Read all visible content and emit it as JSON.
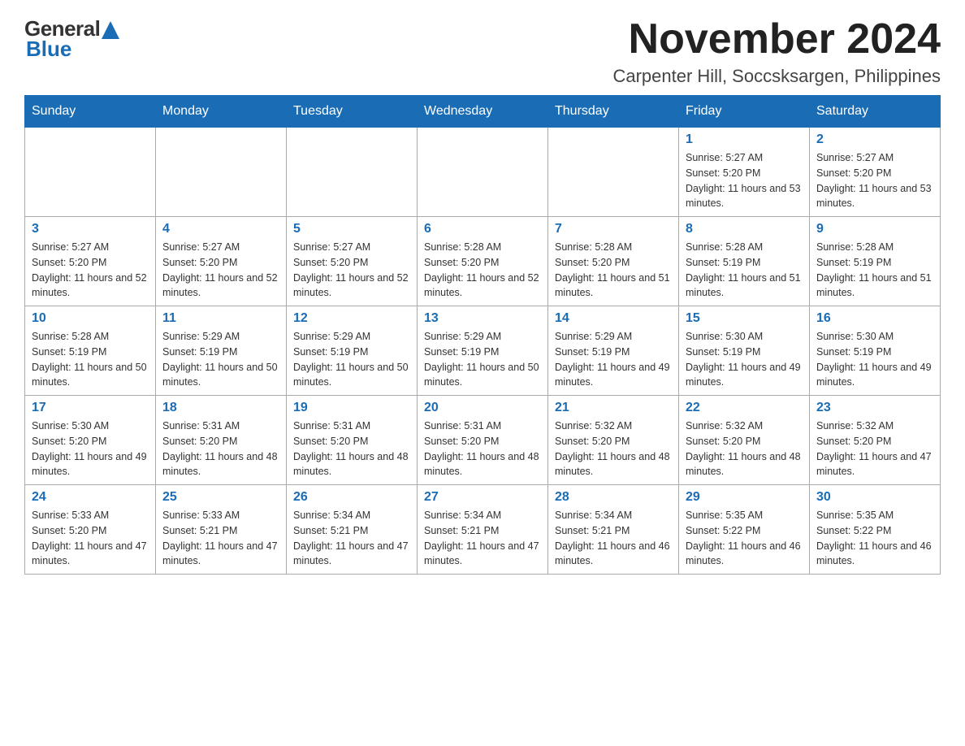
{
  "logo": {
    "general": "General",
    "blue": "Blue"
  },
  "header": {
    "month_year": "November 2024",
    "location": "Carpenter Hill, Soccsksargen, Philippines"
  },
  "weekdays": [
    "Sunday",
    "Monday",
    "Tuesday",
    "Wednesday",
    "Thursday",
    "Friday",
    "Saturday"
  ],
  "weeks": [
    [
      {
        "day": "",
        "sunrise": "",
        "sunset": "",
        "daylight": ""
      },
      {
        "day": "",
        "sunrise": "",
        "sunset": "",
        "daylight": ""
      },
      {
        "day": "",
        "sunrise": "",
        "sunset": "",
        "daylight": ""
      },
      {
        "day": "",
        "sunrise": "",
        "sunset": "",
        "daylight": ""
      },
      {
        "day": "",
        "sunrise": "",
        "sunset": "",
        "daylight": ""
      },
      {
        "day": "1",
        "sunrise": "Sunrise: 5:27 AM",
        "sunset": "Sunset: 5:20 PM",
        "daylight": "Daylight: 11 hours and 53 minutes."
      },
      {
        "day": "2",
        "sunrise": "Sunrise: 5:27 AM",
        "sunset": "Sunset: 5:20 PM",
        "daylight": "Daylight: 11 hours and 53 minutes."
      }
    ],
    [
      {
        "day": "3",
        "sunrise": "Sunrise: 5:27 AM",
        "sunset": "Sunset: 5:20 PM",
        "daylight": "Daylight: 11 hours and 52 minutes."
      },
      {
        "day": "4",
        "sunrise": "Sunrise: 5:27 AM",
        "sunset": "Sunset: 5:20 PM",
        "daylight": "Daylight: 11 hours and 52 minutes."
      },
      {
        "day": "5",
        "sunrise": "Sunrise: 5:27 AM",
        "sunset": "Sunset: 5:20 PM",
        "daylight": "Daylight: 11 hours and 52 minutes."
      },
      {
        "day": "6",
        "sunrise": "Sunrise: 5:28 AM",
        "sunset": "Sunset: 5:20 PM",
        "daylight": "Daylight: 11 hours and 52 minutes."
      },
      {
        "day": "7",
        "sunrise": "Sunrise: 5:28 AM",
        "sunset": "Sunset: 5:20 PM",
        "daylight": "Daylight: 11 hours and 51 minutes."
      },
      {
        "day": "8",
        "sunrise": "Sunrise: 5:28 AM",
        "sunset": "Sunset: 5:19 PM",
        "daylight": "Daylight: 11 hours and 51 minutes."
      },
      {
        "day": "9",
        "sunrise": "Sunrise: 5:28 AM",
        "sunset": "Sunset: 5:19 PM",
        "daylight": "Daylight: 11 hours and 51 minutes."
      }
    ],
    [
      {
        "day": "10",
        "sunrise": "Sunrise: 5:28 AM",
        "sunset": "Sunset: 5:19 PM",
        "daylight": "Daylight: 11 hours and 50 minutes."
      },
      {
        "day": "11",
        "sunrise": "Sunrise: 5:29 AM",
        "sunset": "Sunset: 5:19 PM",
        "daylight": "Daylight: 11 hours and 50 minutes."
      },
      {
        "day": "12",
        "sunrise": "Sunrise: 5:29 AM",
        "sunset": "Sunset: 5:19 PM",
        "daylight": "Daylight: 11 hours and 50 minutes."
      },
      {
        "day": "13",
        "sunrise": "Sunrise: 5:29 AM",
        "sunset": "Sunset: 5:19 PM",
        "daylight": "Daylight: 11 hours and 50 minutes."
      },
      {
        "day": "14",
        "sunrise": "Sunrise: 5:29 AM",
        "sunset": "Sunset: 5:19 PM",
        "daylight": "Daylight: 11 hours and 49 minutes."
      },
      {
        "day": "15",
        "sunrise": "Sunrise: 5:30 AM",
        "sunset": "Sunset: 5:19 PM",
        "daylight": "Daylight: 11 hours and 49 minutes."
      },
      {
        "day": "16",
        "sunrise": "Sunrise: 5:30 AM",
        "sunset": "Sunset: 5:19 PM",
        "daylight": "Daylight: 11 hours and 49 minutes."
      }
    ],
    [
      {
        "day": "17",
        "sunrise": "Sunrise: 5:30 AM",
        "sunset": "Sunset: 5:20 PM",
        "daylight": "Daylight: 11 hours and 49 minutes."
      },
      {
        "day": "18",
        "sunrise": "Sunrise: 5:31 AM",
        "sunset": "Sunset: 5:20 PM",
        "daylight": "Daylight: 11 hours and 48 minutes."
      },
      {
        "day": "19",
        "sunrise": "Sunrise: 5:31 AM",
        "sunset": "Sunset: 5:20 PM",
        "daylight": "Daylight: 11 hours and 48 minutes."
      },
      {
        "day": "20",
        "sunrise": "Sunrise: 5:31 AM",
        "sunset": "Sunset: 5:20 PM",
        "daylight": "Daylight: 11 hours and 48 minutes."
      },
      {
        "day": "21",
        "sunrise": "Sunrise: 5:32 AM",
        "sunset": "Sunset: 5:20 PM",
        "daylight": "Daylight: 11 hours and 48 minutes."
      },
      {
        "day": "22",
        "sunrise": "Sunrise: 5:32 AM",
        "sunset": "Sunset: 5:20 PM",
        "daylight": "Daylight: 11 hours and 48 minutes."
      },
      {
        "day": "23",
        "sunrise": "Sunrise: 5:32 AM",
        "sunset": "Sunset: 5:20 PM",
        "daylight": "Daylight: 11 hours and 47 minutes."
      }
    ],
    [
      {
        "day": "24",
        "sunrise": "Sunrise: 5:33 AM",
        "sunset": "Sunset: 5:20 PM",
        "daylight": "Daylight: 11 hours and 47 minutes."
      },
      {
        "day": "25",
        "sunrise": "Sunrise: 5:33 AM",
        "sunset": "Sunset: 5:21 PM",
        "daylight": "Daylight: 11 hours and 47 minutes."
      },
      {
        "day": "26",
        "sunrise": "Sunrise: 5:34 AM",
        "sunset": "Sunset: 5:21 PM",
        "daylight": "Daylight: 11 hours and 47 minutes."
      },
      {
        "day": "27",
        "sunrise": "Sunrise: 5:34 AM",
        "sunset": "Sunset: 5:21 PM",
        "daylight": "Daylight: 11 hours and 47 minutes."
      },
      {
        "day": "28",
        "sunrise": "Sunrise: 5:34 AM",
        "sunset": "Sunset: 5:21 PM",
        "daylight": "Daylight: 11 hours and 46 minutes."
      },
      {
        "day": "29",
        "sunrise": "Sunrise: 5:35 AM",
        "sunset": "Sunset: 5:22 PM",
        "daylight": "Daylight: 11 hours and 46 minutes."
      },
      {
        "day": "30",
        "sunrise": "Sunrise: 5:35 AM",
        "sunset": "Sunset: 5:22 PM",
        "daylight": "Daylight: 11 hours and 46 minutes."
      }
    ]
  ]
}
